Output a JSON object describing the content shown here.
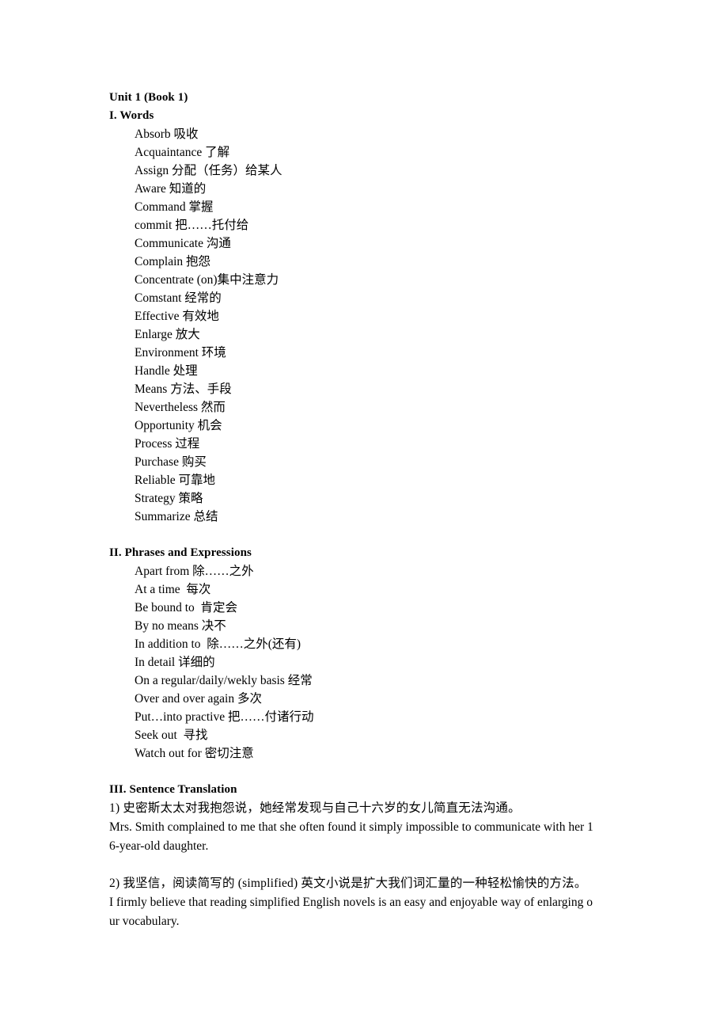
{
  "document": {
    "title": "Unit 1 (Book 1)"
  },
  "sections": [
    {
      "heading": "I. Words",
      "entries": [
        "Absorb 吸收",
        "Acquaintance 了解",
        "Assign 分配（任务）给某人",
        "Aware 知道的",
        "Command 掌握",
        "commit 把……托付给",
        "Communicate 沟通",
        "Complain 抱怨",
        "Concentrate (on)集中注意力",
        "Comstant 经常的",
        "Effective 有效地",
        "Enlarge 放大",
        "Environment 环境",
        "Handle 处理",
        "Means 方法、手段",
        "Nevertheless 然而",
        "Opportunity 机会",
        "Process 过程",
        "Purchase 购买",
        "Reliable 可靠地",
        "Strategy 策略",
        "Summarize 总结"
      ]
    },
    {
      "heading": "II. Phrases and Expressions",
      "entries": [
        "Apart from 除……之外",
        "At a time  每次",
        "Be bound to  肯定会",
        "By no means 决不",
        "In addition to  除……之外(还有)",
        "In detail 详细的",
        "On a regular/daily/wekly basis 经常",
        "Over and over again 多次",
        "Put…into practive 把……付诸行动",
        "Seek out  寻找",
        "Watch out for 密切注意"
      ]
    }
  ],
  "translation_section": {
    "heading": "III. Sentence Translation",
    "items": [
      {
        "chinese": "1) 史密斯太太对我抱怨说，她经常发现与自己十六岁的女儿简直无法沟通。",
        "english_line1": "Mrs. Smith complained to me that she often found it simply impossible to communicate with her 1",
        "english_line2": "6-year-old daughter."
      },
      {
        "chinese": "2) 我坚信，阅读简写的 (simplified) 英文小说是扩大我们词汇量的一种轻松愉快的方法。",
        "english_line1": "I firmly believe that reading simplified English novels is an easy and enjoyable way of enlarging o",
        "english_line2": "ur vocabulary."
      }
    ]
  }
}
